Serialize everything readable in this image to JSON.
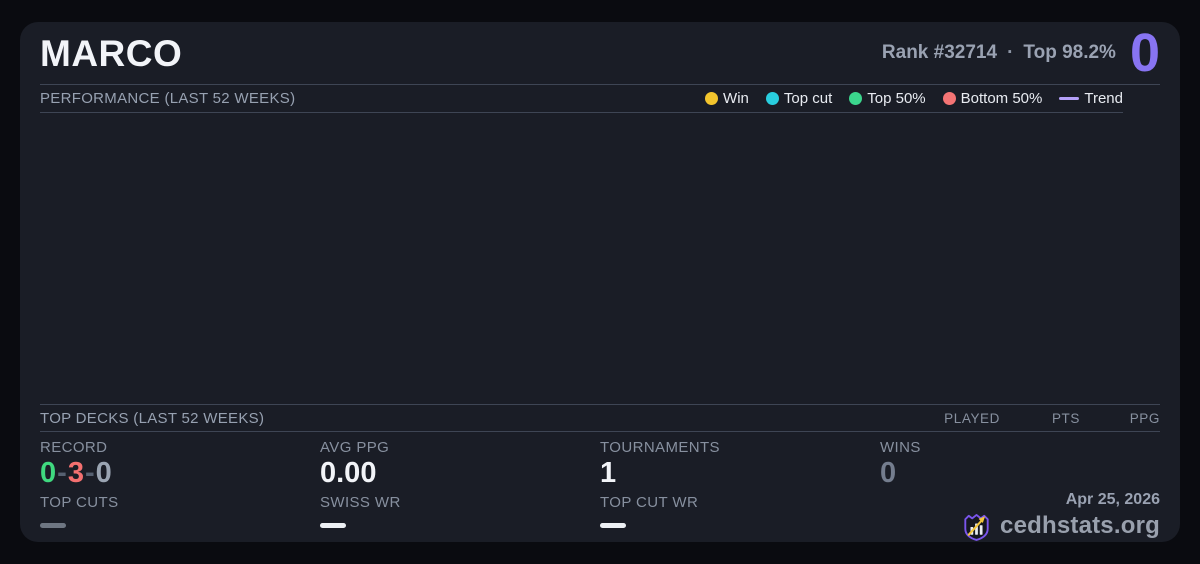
{
  "colors": {
    "accent_purple": "#8874f2",
    "record_green": "#3fd97f",
    "record_red": "#f47070",
    "record_gray": "#9aa4b2",
    "wins_muted_gray": "#747d8e",
    "empty_bar_gray": "#6e7682",
    "empty_bar_white": "#edf0f4"
  },
  "header": {
    "player_name": "MARCO",
    "rank": "Rank #32714",
    "separator": "·",
    "top_percent": "Top 98.2%",
    "score": "0"
  },
  "performance": {
    "title": "PERFORMANCE (LAST 52 WEEKS)",
    "legend": [
      {
        "label": "Win",
        "color": "#f3c52d",
        "marker": "dot"
      },
      {
        "label": "Top cut",
        "color": "#29cede",
        "marker": "dot"
      },
      {
        "label": "Top 50%",
        "color": "#3bd68d",
        "marker": "dot"
      },
      {
        "label": "Bottom 50%",
        "color": "#f47474",
        "marker": "dot"
      },
      {
        "label": "Trend",
        "color": "#b4a0f8",
        "marker": "line"
      }
    ]
  },
  "chart_data": {
    "type": "scatter",
    "title": "PERFORMANCE (LAST 52 WEEKS)",
    "legend": [
      "Win",
      "Top cut",
      "Top 50%",
      "Bottom 50%",
      "Trend"
    ],
    "series": [],
    "points": [],
    "empty": true
  },
  "top_decks": {
    "title": "TOP DECKS (LAST 52 WEEKS)",
    "columns": [
      "PLAYED",
      "PTS",
      "PPG"
    ],
    "rows": []
  },
  "stats": {
    "record": {
      "label": "RECORD",
      "wins": "0",
      "losses": "3",
      "draws": "0",
      "separator": "-"
    },
    "avg_ppg": {
      "label": "AVG PPG",
      "value": "0.00"
    },
    "tournaments": {
      "label": "TOURNAMENTS",
      "value": "1"
    },
    "wins": {
      "label": "WINS",
      "value": "0"
    },
    "top_cuts": {
      "label": "TOP CUTS",
      "value": "—"
    },
    "swiss_wr": {
      "label": "SWISS WR",
      "value": "—"
    },
    "top_cut_wr": {
      "label": "TOP CUT WR",
      "value": "—"
    }
  },
  "footer": {
    "date": "Apr 25, 2026",
    "brand": "cedhstats.org",
    "logo": {
      "shield_color": "#7a55ec",
      "bar_color": "#e9ecf2",
      "arrow_color": "#f2c63c"
    }
  }
}
